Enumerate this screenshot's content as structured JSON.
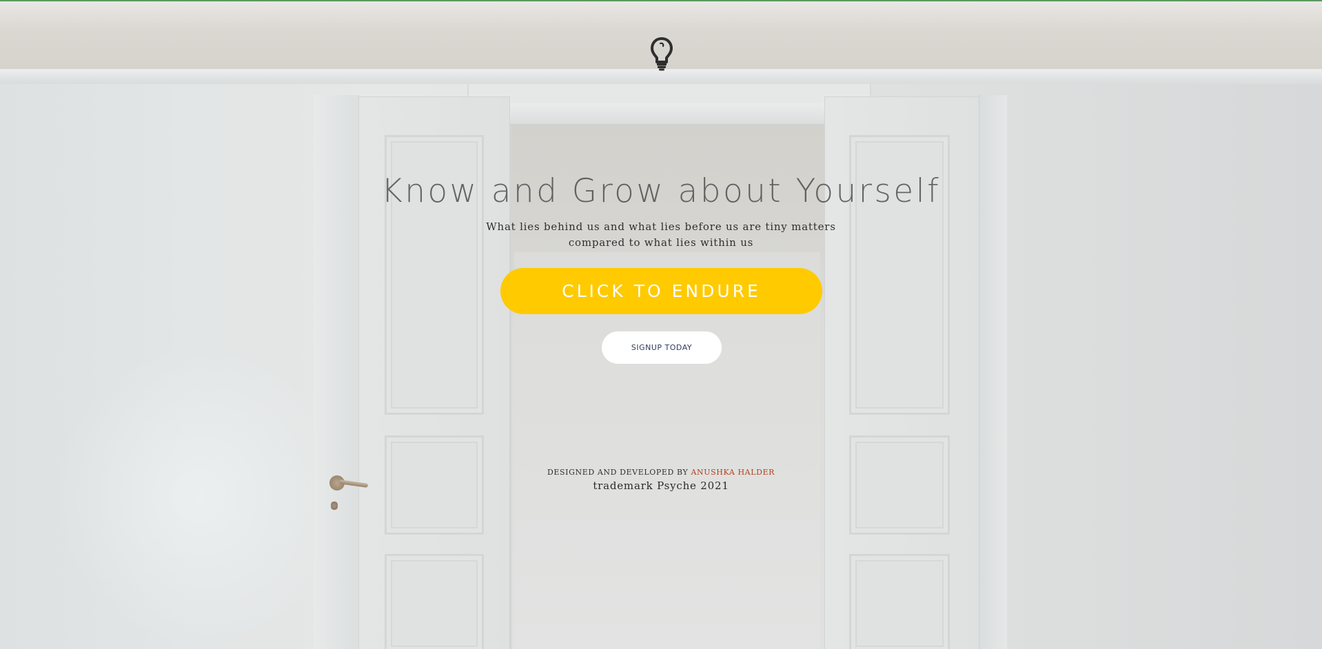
{
  "header": {
    "logo_icon": "lightbulb-icon"
  },
  "hero": {
    "title": "Know and Grow about Yourself",
    "subtitle_line1": "What lies behind us and what lies before us are tiny matters",
    "subtitle_line2": "compared to what lies within us"
  },
  "actions": {
    "cta_label": "CLICK TO ENDURE",
    "signup_label": "SIGNUP TODAY"
  },
  "footer": {
    "credit_prefix": "DESIGNED AND DEVELOPED BY",
    "author": "ANUSHKA HALDER",
    "trademark": "trademark Psyche 2021"
  },
  "colors": {
    "cta_background": "#ffca00",
    "cta_text": "#ffffff",
    "signup_background": "#ffffff",
    "signup_text": "#2c3e5a",
    "author_link": "#b2401f",
    "top_border": "#5a9a5f"
  }
}
